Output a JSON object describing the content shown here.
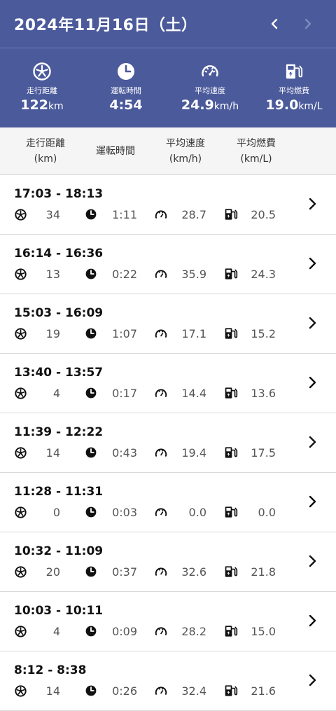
{
  "header": {
    "date": "2024年11月16日（土）"
  },
  "summary": {
    "distance": {
      "label": "走行距離",
      "value": "122",
      "unit": "km",
      "icon": "tire-icon"
    },
    "duration": {
      "label": "運転時間",
      "value": "4:54",
      "unit": "",
      "icon": "clock-icon"
    },
    "speed": {
      "label": "平均速度",
      "value": "24.9",
      "unit": "km/h",
      "icon": "speedometer-icon"
    },
    "fuel": {
      "label": "平均燃費",
      "value": "19.0",
      "unit": "km/L",
      "icon": "fuel-pump-icon"
    }
  },
  "columns": {
    "distance": {
      "line1": "走行距離",
      "line2": "(km)"
    },
    "duration": {
      "line1": "運転時間",
      "line2": ""
    },
    "speed": {
      "line1": "平均速度",
      "line2": "(km/h)"
    },
    "fuel": {
      "line1": "平均燃費",
      "line2": "(km/L)"
    }
  },
  "trips": [
    {
      "time": "17:03 - 18:13",
      "distance": "34",
      "duration": "1:11",
      "speed": "28.7",
      "fuel": "20.5"
    },
    {
      "time": "16:14 - 16:36",
      "distance": "13",
      "duration": "0:22",
      "speed": "35.9",
      "fuel": "24.3"
    },
    {
      "time": "15:03 - 16:09",
      "distance": "19",
      "duration": "1:07",
      "speed": "17.1",
      "fuel": "15.2"
    },
    {
      "time": "13:40 - 13:57",
      "distance": "4",
      "duration": "0:17",
      "speed": "14.4",
      "fuel": "13.6"
    },
    {
      "time": "11:39 - 12:22",
      "distance": "14",
      "duration": "0:43",
      "speed": "19.4",
      "fuel": "17.5"
    },
    {
      "time": "11:28 - 11:31",
      "distance": "0",
      "duration": "0:03",
      "speed": "0.0",
      "fuel": "0.0"
    },
    {
      "time": "10:32 - 11:09",
      "distance": "20",
      "duration": "0:37",
      "speed": "32.6",
      "fuel": "21.8"
    },
    {
      "time": "10:03 - 10:11",
      "distance": "4",
      "duration": "0:09",
      "speed": "28.2",
      "fuel": "15.0"
    },
    {
      "time": "8:12 - 8:38",
      "distance": "14",
      "duration": "0:26",
      "speed": "32.4",
      "fuel": "21.6"
    }
  ],
  "colors": {
    "header_bg": "#4b5a9b",
    "nav_next_disabled": "#7f8bbd"
  }
}
